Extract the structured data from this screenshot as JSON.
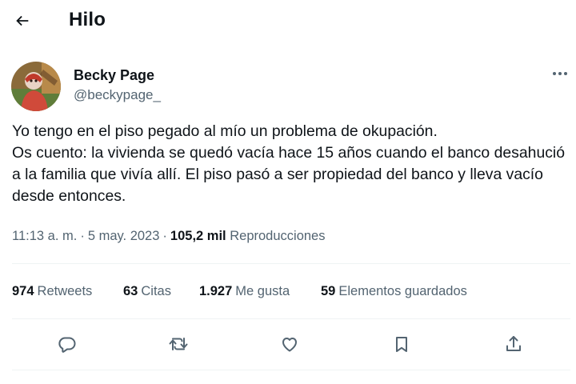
{
  "header": {
    "title": "Hilo",
    "back_icon": "arrow-left-icon"
  },
  "author": {
    "display_name": "Becky Page",
    "handle": "@beckypage_"
  },
  "tweet": {
    "text": "Yo tengo en el piso pegado al mío un problema de okupación.\nOs cuento: la vivienda se quedó vacía hace 15 años cuando el banco desahució a la familia que vivía allí. El piso pasó a ser propiedad del banco y lleva vacío desde entonces.",
    "time": "11:13 a. m.",
    "separator": "·",
    "date": "5 may. 2023",
    "views_count": "105,2 mil",
    "views_label": "Reproducciones"
  },
  "stats": {
    "retweets": {
      "count": "974",
      "label": "Retweets"
    },
    "quotes": {
      "count": "63",
      "label": "Citas"
    },
    "likes": {
      "count": "1.927",
      "label": "Me gusta"
    },
    "bookmarks": {
      "count": "59",
      "label": "Elementos guardados"
    }
  },
  "actions": [
    "reply-icon",
    "retweet-icon",
    "like-icon",
    "bookmark-icon",
    "share-icon"
  ],
  "colors": {
    "text": "#0f1419",
    "secondary": "#536471",
    "divider": "#eff3f4"
  }
}
